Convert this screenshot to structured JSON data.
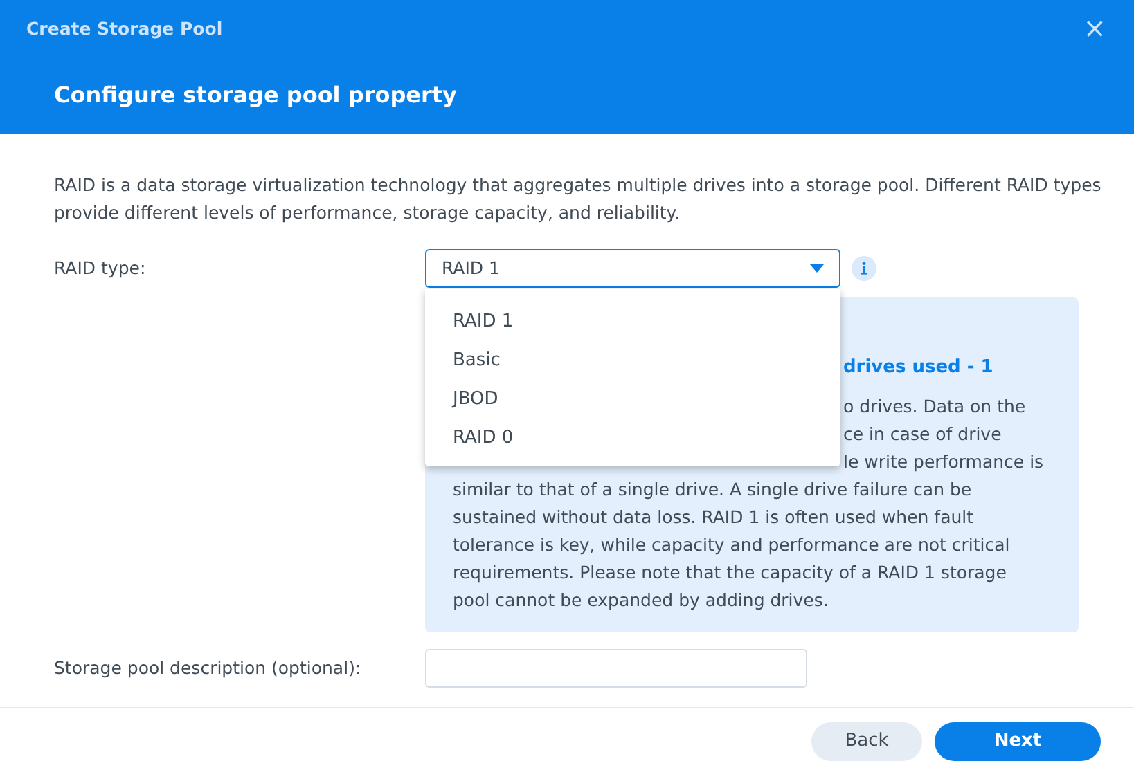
{
  "window": {
    "title": "Create Storage Pool",
    "close": "×"
  },
  "step_title": "Configure storage pool property",
  "intro": "RAID is a data storage virtualization technology that aggregates multiple drives into a storage pool. Different RAID types provide different levels of performance, storage capacity, and reliability.",
  "raid_type": {
    "label": "RAID type:",
    "value": "RAID 1",
    "options": [
      "RAID 1",
      "Basic",
      "JBOD",
      "RAID 0"
    ]
  },
  "info_box": {
    "heading": "drives used - 1",
    "cut_lines": [
      "o drives. Data on the",
      "ce in case of drive",
      "le write performance is"
    ],
    "lines": [
      "similar to that of a single drive. A single drive failure can be",
      "sustained without data loss. RAID 1 is often used when fault",
      "tolerance is key, while capacity and performance are not critical",
      "requirements. Please note that the capacity of a RAID 1 storage",
      "pool cannot be expanded by adding drives."
    ]
  },
  "description": {
    "label": "Storage pool description (optional):"
  },
  "buttons": [
    {
      "label": "Back",
      "kind": "secondary"
    },
    {
      "label": "Next",
      "kind": "primary"
    }
  ]
}
